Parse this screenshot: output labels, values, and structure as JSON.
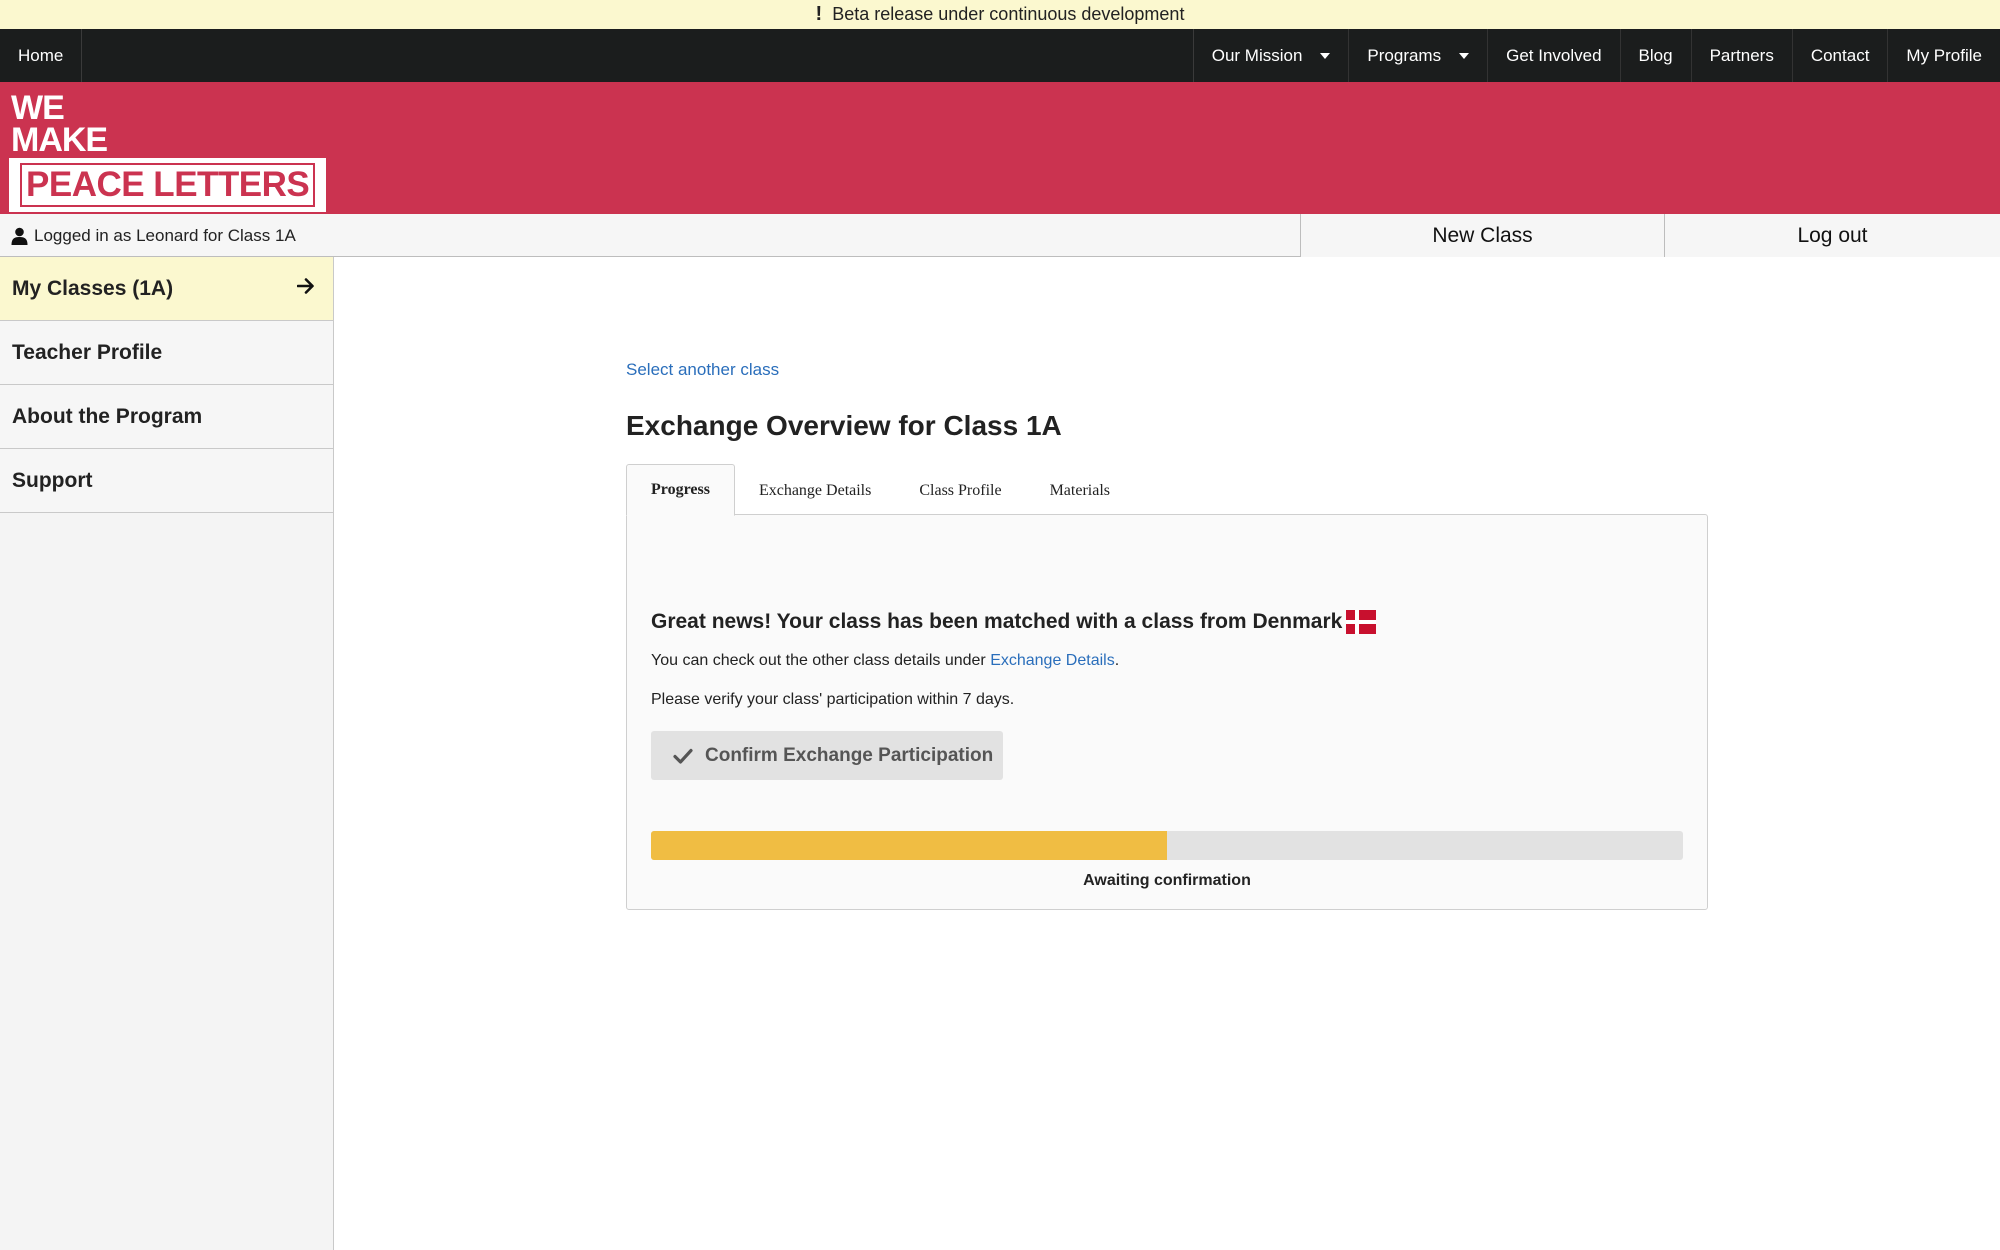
{
  "banner": {
    "icon": "exclamation-icon",
    "text": "Beta release under continuous development"
  },
  "nav": {
    "home": "Home",
    "items": [
      {
        "label": "Our Mission",
        "dropdown": true
      },
      {
        "label": "Programs",
        "dropdown": true
      },
      {
        "label": "Get Involved",
        "dropdown": false
      },
      {
        "label": "Blog",
        "dropdown": false
      },
      {
        "label": "Partners",
        "dropdown": false
      },
      {
        "label": "Contact",
        "dropdown": false
      },
      {
        "label": "My Profile",
        "dropdown": false
      }
    ]
  },
  "logo": {
    "line1": "WE",
    "line2": "MAKE",
    "line3": "PEACE LETTERS"
  },
  "status": {
    "user_icon": "user-icon",
    "logged_in": "Logged in as Leonard for Class 1A",
    "new_class": "New Class",
    "log_out": "Log out"
  },
  "sidebar": {
    "items": [
      {
        "label": "My Classes (1A)",
        "active": true,
        "icon": "arrow-right-icon"
      },
      {
        "label": "Teacher Profile"
      },
      {
        "label": "About the Program"
      },
      {
        "label": "Support"
      }
    ]
  },
  "main": {
    "select_link": "Select another class",
    "title": "Exchange Overview for Class 1A",
    "tabs": [
      {
        "label": "Progress",
        "active": true
      },
      {
        "label": "Exchange Details"
      },
      {
        "label": "Class Profile"
      },
      {
        "label": "Materials"
      }
    ],
    "panel": {
      "match_text": "Great news! Your class has been matched with a class from Denmark",
      "flag_icon": "denmark-flag-icon",
      "check_text_prefix": "You can check out the other class details under ",
      "check_link": "Exchange Details",
      "check_text_suffix": ".",
      "verify_text": "Please verify your class' participation within 7 days.",
      "confirm_button": "Confirm Exchange Participation",
      "confirm_icon": "checkmark-icon",
      "progress_fraction": 0.5,
      "progress_label": "Awaiting confirmation"
    }
  },
  "colors": {
    "brand": "#cb3350",
    "nav_bg": "#1b1d1d",
    "banner_bg": "#fbf8cf",
    "link": "#2a6ebb",
    "progress": "#f0bd43"
  }
}
